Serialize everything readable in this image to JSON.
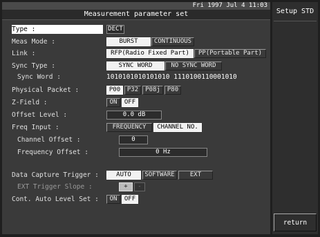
{
  "header": {
    "datetime": "Fri 1997 Jul  4 11:03",
    "title": "Measurement parameter set"
  },
  "side_panel": {
    "title": "Setup STD",
    "return_label": "return"
  },
  "params": {
    "type_label": "Type :",
    "type_value": "DECT",
    "meas_mode_label": "Meas Mode :",
    "meas_mode_options": [
      "BURST",
      "CONTINUOUS"
    ],
    "link_label": "Link :",
    "link_options": [
      "RFP(Radio Fixed Part)",
      "PP(Portable Part)"
    ],
    "sync_type_label": "Sync Type :",
    "sync_type_options": [
      "SYNC WORD",
      "NO SYNC WORD"
    ],
    "sync_word_label": "Sync Word :",
    "sync_word_value": "1010101010101010 1110100110001010",
    "physical_packet_label": "Physical Packet :",
    "physical_packet_options": [
      "P00",
      "P32",
      "P08j",
      "P80"
    ],
    "zfield_label": "Z-Field :",
    "zfield_options": [
      "ON",
      "OFF"
    ],
    "offset_level_label": "Offset Level :",
    "offset_level_value": "0.0 dB",
    "freq_input_label": "Freq Input :",
    "freq_input_options": [
      "FREQUENCY",
      "CHANNEL NO."
    ],
    "channel_offset_label": "Channel Offset :",
    "channel_offset_value": "0",
    "frequency_offset_label": "Frequency Offset :",
    "frequency_offset_value": "0 Hz",
    "capture_trigger_label": "Data Capture Trigger :",
    "capture_trigger_options": [
      "AUTO",
      "SOFTWARE",
      "EXT"
    ],
    "ext_slope_label": "EXT Trigger Slope :",
    "ext_slope_options": [
      "+",
      "-"
    ],
    "auto_level_label": "Cont. Auto Level Set :",
    "auto_level_options": [
      "ON",
      "OFF"
    ]
  }
}
